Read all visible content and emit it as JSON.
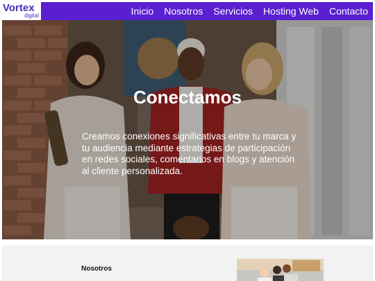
{
  "brand": {
    "name": "Vortex",
    "sub": "digital"
  },
  "nav": {
    "items": [
      {
        "label": "Inicio"
      },
      {
        "label": "Nosotros"
      },
      {
        "label": "Servicios"
      },
      {
        "label": "Hosting Web"
      },
      {
        "label": "Contacto"
      }
    ]
  },
  "hero": {
    "title": "Conectamos",
    "text": "Creamos conexiones significativas entre tu marca y tu audiencia mediante estrategias de participación en redes sociales, comentarios en blogs y atención al cliente personalizada."
  },
  "about": {
    "title": "Nosotros"
  },
  "colors": {
    "nav_bg": "#5a1fd1",
    "brand": "#4a2bb8"
  }
}
